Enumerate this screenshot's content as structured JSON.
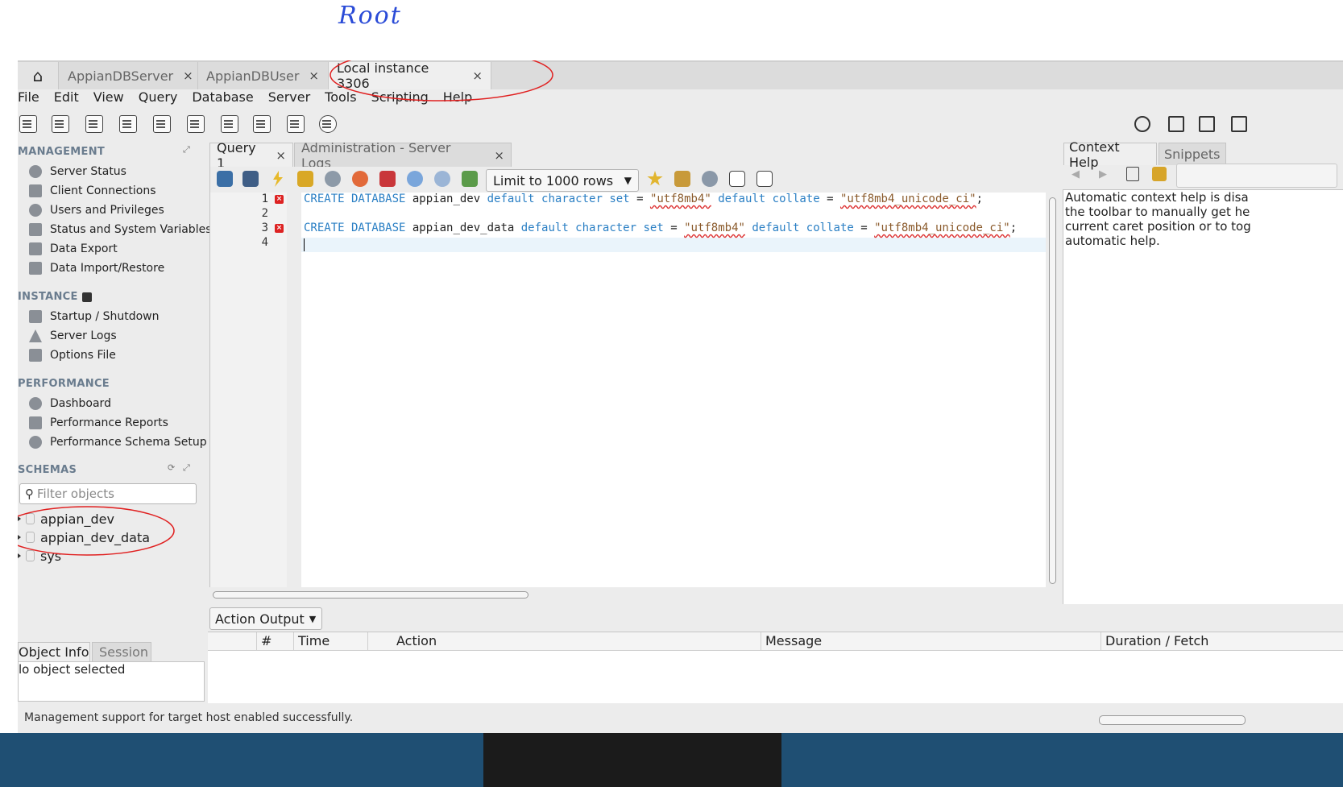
{
  "annotation": {
    "text": "Root"
  },
  "conn_tabs": [
    {
      "label": "AppianDBServer",
      "close": "×"
    },
    {
      "label": "AppianDBUser",
      "close": "×"
    },
    {
      "label": "Local instance 3306",
      "close": "×"
    }
  ],
  "menu": [
    "File",
    "Edit",
    "View",
    "Query",
    "Database",
    "Server",
    "Tools",
    "Scripting",
    "Help"
  ],
  "sidebar": {
    "management_title": "MANAGEMENT",
    "management": [
      "Server Status",
      "Client Connections",
      "Users and Privileges",
      "Status and System Variables",
      "Data Export",
      "Data Import/Restore"
    ],
    "instance_title": "INSTANCE",
    "instance": [
      "Startup / Shutdown",
      "Server Logs",
      "Options File"
    ],
    "performance_title": "PERFORMANCE",
    "performance": [
      "Dashboard",
      "Performance Reports",
      "Performance Schema Setup"
    ],
    "schemas_title": "SCHEMAS",
    "filter_placeholder": "Filter objects",
    "schemas": [
      "appian_dev",
      "appian_dev_data",
      "sys"
    ]
  },
  "query_tabs": [
    {
      "label": "Query 1",
      "close": "×"
    },
    {
      "label": "Administration - Server Logs",
      "close": "×"
    }
  ],
  "limit_select": "Limit to 1000 rows",
  "editor": {
    "line_numbers": [
      "1",
      "2",
      "3",
      "4"
    ],
    "error_mark": "×",
    "line1": {
      "kw1": "CREATE DATABASE",
      "name": "appian_dev",
      "kw2": "default character set",
      "eq1": "=",
      "charset": "\"utf8mb4\"",
      "kw3": "default collate",
      "eq2": "=",
      "collate": "\"utf8mb4_unicode_ci\"",
      "end": ";"
    },
    "line3": {
      "kw1": "CREATE DATABASE",
      "name": "appian_dev_data",
      "kw2": "default character set",
      "eq1": "=",
      "charset": "\"utf8mb4\"",
      "kw3": "default collate",
      "eq2": "=",
      "collate": "\"utf8mb4_unicode_ci\"",
      "end": ";"
    }
  },
  "right_panel": {
    "tabs": [
      "Context Help",
      "Snippets"
    ],
    "help_lines": [
      "Automatic context help is disa",
      "the toolbar to manually get he",
      "current caret position or to tog",
      "automatic help."
    ]
  },
  "output": {
    "dropdown": "Action Output",
    "columns": [
      "#",
      "Time",
      "Action",
      "Message",
      "Duration / Fetch"
    ]
  },
  "object_info": {
    "tabs": [
      "Object Info",
      "Session"
    ],
    "empty": "lo object selected"
  },
  "status_message": "Management support for target host enabled successfully.",
  "colors": {
    "annotation": "#e02020",
    "keyword": "#2a7fc4",
    "string": "#8a5a2b",
    "section_title": "#6a7c8e"
  }
}
